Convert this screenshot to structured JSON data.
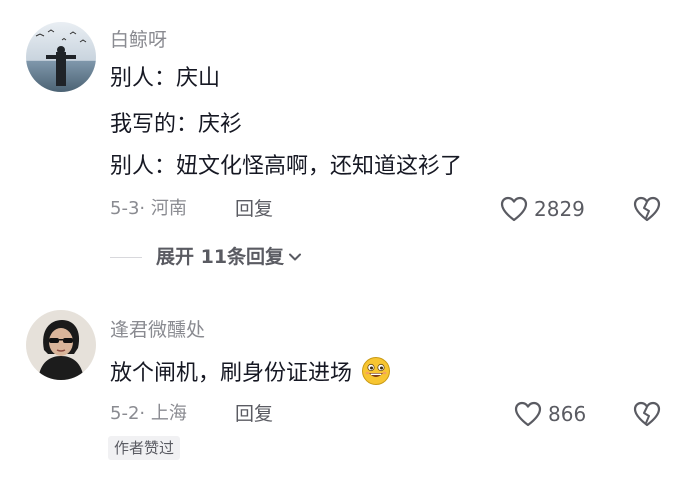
{
  "comments": [
    {
      "username": "白鲸呀",
      "lines": [
        "别人：庆山",
        "我写的：庆衫",
        "别人：妞文化怪高啊，还知道这衫了"
      ],
      "meta": "5-3· 河南",
      "reply_label": "回复",
      "like_count": "2829",
      "expand_label": "展开 11条回复"
    },
    {
      "username": "逢君微醺处",
      "lines": [
        "放个闸机，刷身份证进场"
      ],
      "meta": "5-2· 上海",
      "reply_label": "回复",
      "like_count": "866",
      "badge": "作者赞过"
    }
  ],
  "icons": {
    "like": "heart-outline-icon",
    "dislike": "broken-heart-icon",
    "expand": "chevron-down-icon",
    "emoji": "grinning-emoji-icon"
  },
  "colors": {
    "text": "#161823",
    "muted": "#8a8b91",
    "secondary": "#5a5b62"
  }
}
